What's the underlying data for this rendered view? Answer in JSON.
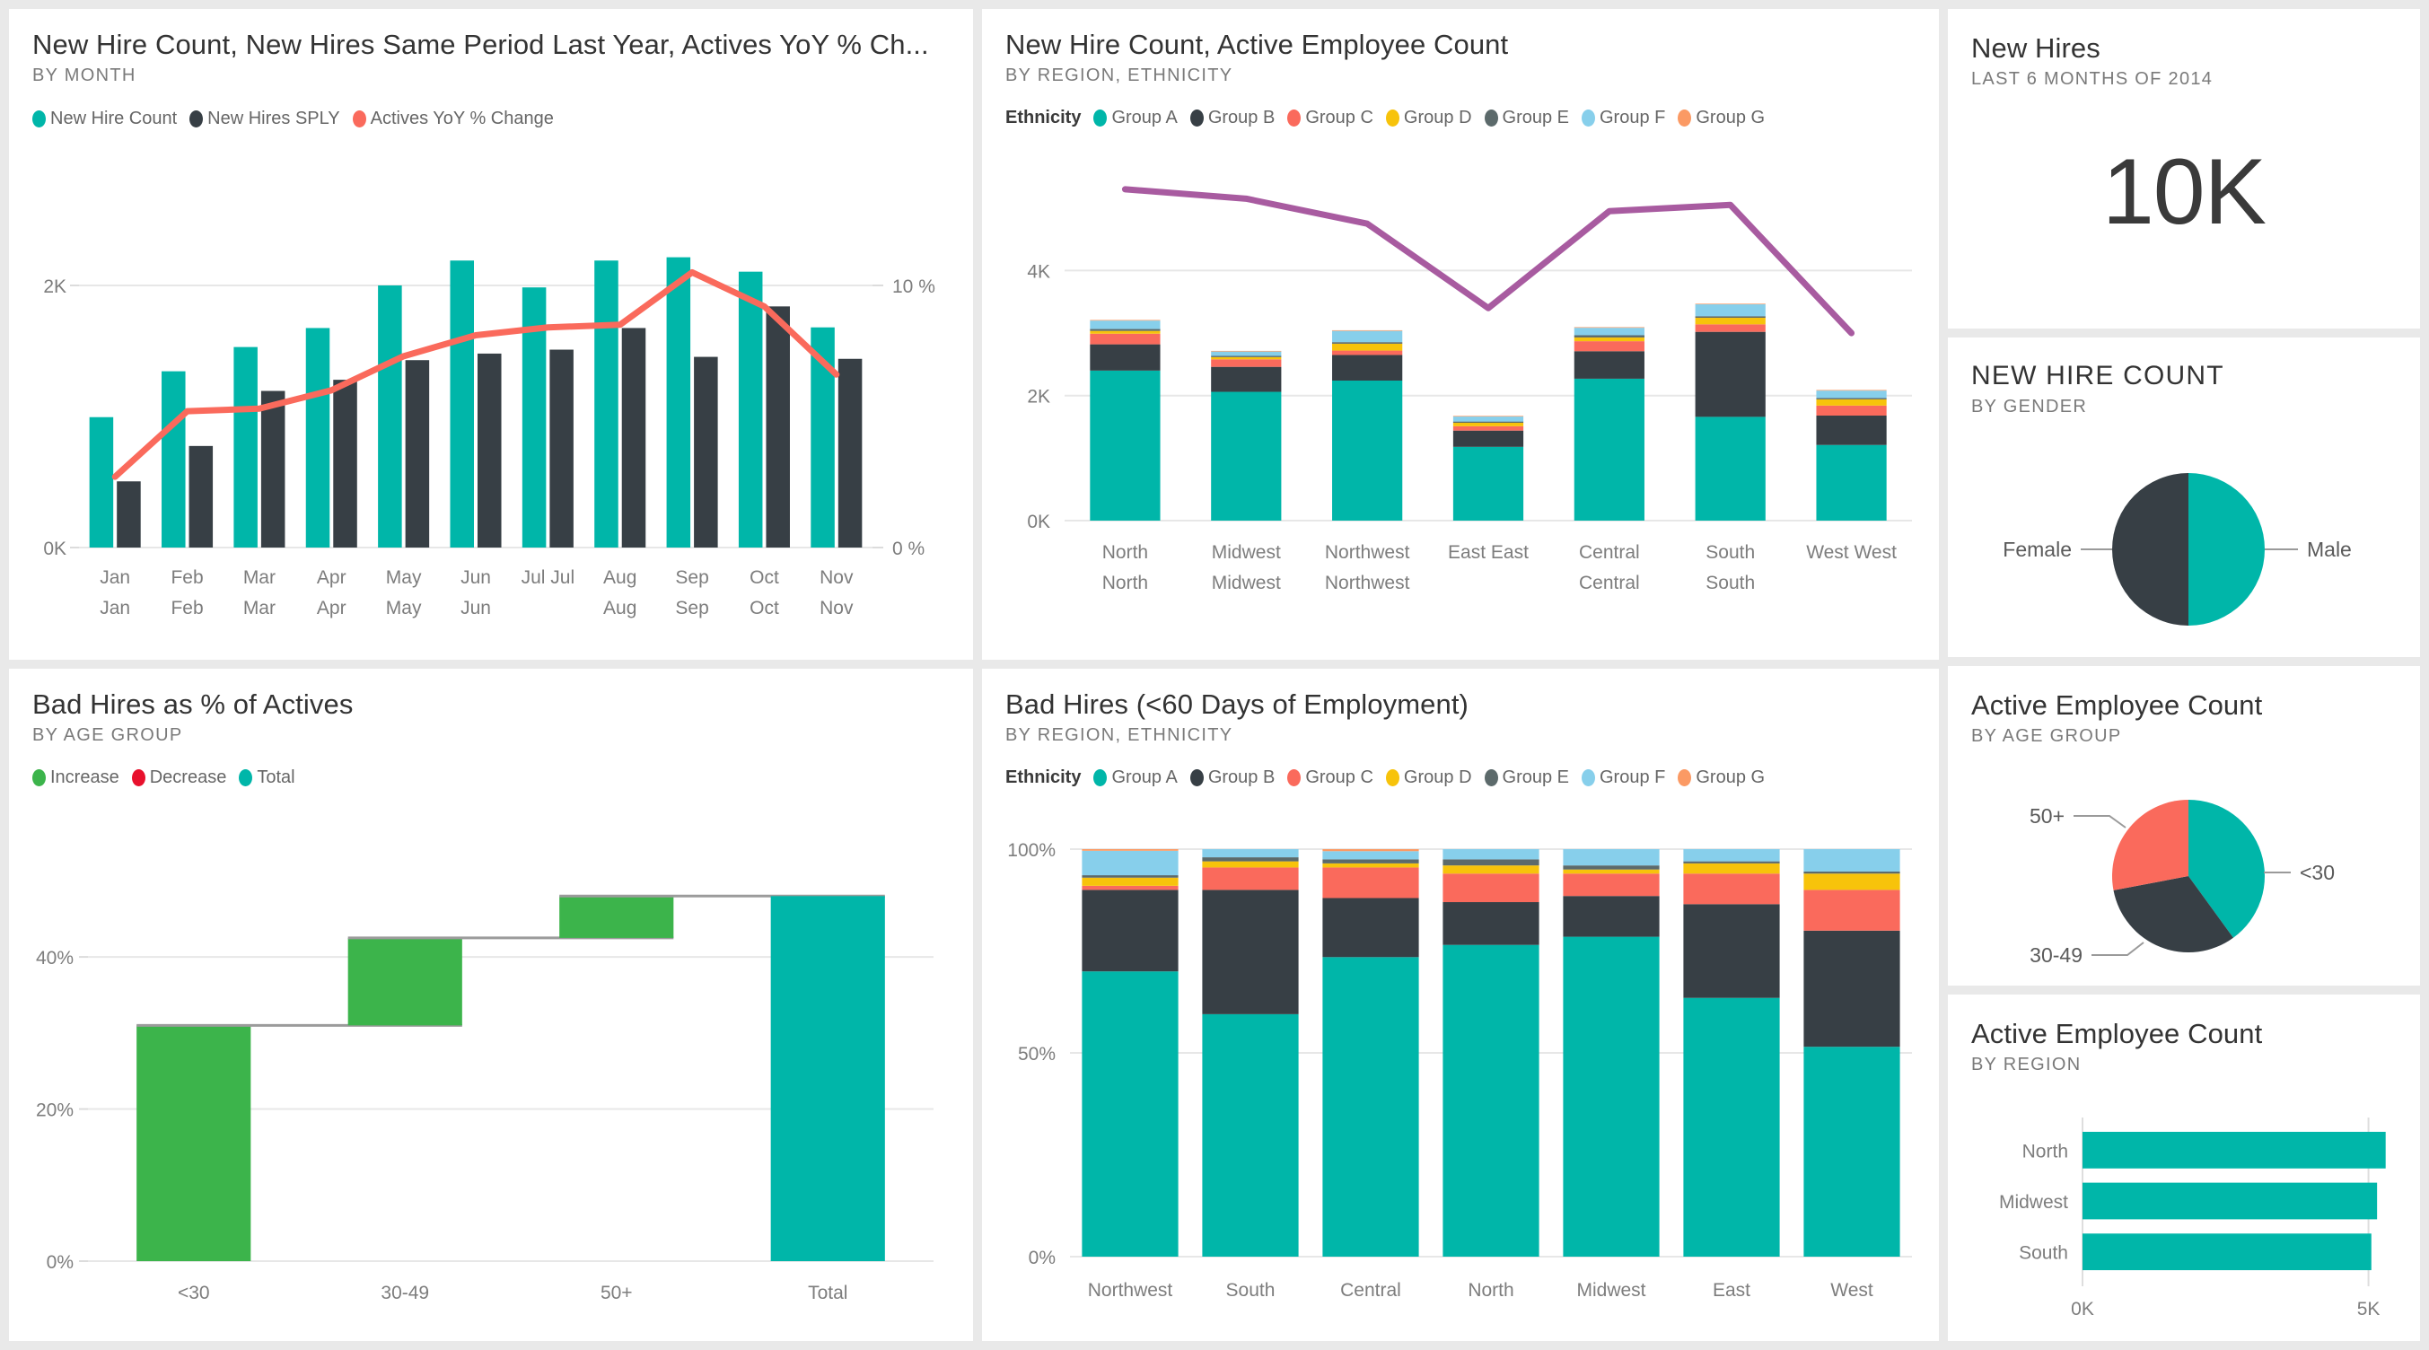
{
  "theme": {
    "page_bg": "#e9e9e9",
    "card_bg": "#ffffff",
    "teal": "#00b6a9",
    "dark": "#373f45",
    "red": "#fa6a5c",
    "yellow": "#f7c30b",
    "gray_green": "#5c6a6b",
    "light_blue": "#87cfeb",
    "orange": "#fb9a64",
    "green": "#3cb44b",
    "decrease_red": "#e8112d",
    "purple": "#a85ba0",
    "text_dark": "#333333",
    "text_muted": "#7a7a7a"
  },
  "cards": {
    "new_hire_trend": {
      "title": "New Hire Count, New Hires Same Period Last Year, Actives YoY % Ch...",
      "subtitle": "BY MONTH",
      "legend": [
        {
          "label": "New Hire Count",
          "color": "#00b6a9"
        },
        {
          "label": "New Hires SPLY",
          "color": "#373f45"
        },
        {
          "label": "Actives YoY % Change",
          "color": "#fa6a5c"
        }
      ]
    },
    "new_hire_active_by_region": {
      "title": "New Hire Count, Active Employee Count",
      "subtitle": "BY REGION, ETHNICITY",
      "legend_title": "Ethnicity",
      "legend": [
        {
          "label": "Group A",
          "color": "#00b6a9"
        },
        {
          "label": "Group B",
          "color": "#373f45"
        },
        {
          "label": "Group C",
          "color": "#fa6a5c"
        },
        {
          "label": "Group D",
          "color": "#f7c30b"
        },
        {
          "label": "Group E",
          "color": "#5c6a6b"
        },
        {
          "label": "Group F",
          "color": "#87cfeb"
        },
        {
          "label": "Group G",
          "color": "#fb9a64"
        }
      ]
    },
    "new_hires_kpi": {
      "title": "New Hires",
      "subtitle": "LAST 6 MONTHS OF 2014",
      "value": "10K"
    },
    "new_hire_by_gender": {
      "title": "NEW HIRE COUNT",
      "subtitle": "BY GENDER"
    },
    "bad_hires_pct": {
      "title": "Bad Hires as % of Actives",
      "subtitle": "BY AGE GROUP",
      "legend": [
        {
          "label": "Increase",
          "color": "#3cb44b"
        },
        {
          "label": "Decrease",
          "color": "#e8112d"
        },
        {
          "label": "Total",
          "color": "#00b6a9"
        }
      ]
    },
    "bad_hires_60days": {
      "title": "Bad Hires (<60 Days of Employment)",
      "subtitle": "BY REGION, ETHNICITY",
      "legend_title": "Ethnicity",
      "legend": [
        {
          "label": "Group A",
          "color": "#00b6a9"
        },
        {
          "label": "Group B",
          "color": "#373f45"
        },
        {
          "label": "Group C",
          "color": "#fa6a5c"
        },
        {
          "label": "Group D",
          "color": "#f7c30b"
        },
        {
          "label": "Group E",
          "color": "#5c6a6b"
        },
        {
          "label": "Group F",
          "color": "#87cfeb"
        },
        {
          "label": "Group G",
          "color": "#fb9a64"
        }
      ]
    },
    "active_by_age": {
      "title": "Active Employee Count",
      "subtitle": "BY AGE GROUP"
    },
    "active_by_region": {
      "title": "Active Employee Count",
      "subtitle": "BY REGION"
    }
  },
  "chart_data": [
    {
      "id": "new_hire_trend",
      "type": "bar",
      "title": "New Hire Count, New Hires Same Period Last Year, Actives YoY % Ch...",
      "subtitle": "BY MONTH",
      "xlabel": "",
      "ylabel": "",
      "categories": [
        "Jan",
        "Feb",
        "Mar",
        "Apr",
        "May",
        "Jun",
        "Jul Jul",
        "Aug",
        "Sep",
        "Oct",
        "Nov"
      ],
      "categories_line2": [
        "Jan",
        "Feb",
        "Mar",
        "Apr",
        "May",
        "Jun",
        "",
        "Aug",
        "Sep",
        "Oct",
        "Nov"
      ],
      "series": [
        {
          "name": "New Hire Count",
          "type": "bar",
          "color": "#00b6a9",
          "values": [
            995,
            1345,
            1530,
            1675,
            2000,
            2190,
            1985,
            2190,
            2215,
            2105,
            1680
          ]
        },
        {
          "name": "New Hires SPLY",
          "type": "bar",
          "color": "#373f45",
          "values": [
            505,
            775,
            1195,
            1280,
            1430,
            1480,
            1510,
            1675,
            1455,
            1840,
            1440
          ]
        },
        {
          "name": "Actives YoY % Change",
          "type": "line",
          "color": "#fa6a5c",
          "axis": "right",
          "values": [
            2.7,
            5.2,
            5.3,
            6.0,
            7.3,
            8.1,
            8.4,
            8.5,
            10.5,
            9.2,
            6.6
          ]
        }
      ],
      "ylim": [
        0,
        2500
      ],
      "yticks": [
        "0K",
        "2K"
      ],
      "ylim_right": [
        0,
        12.5
      ],
      "yticks_right": [
        "0 %",
        "10 %"
      ],
      "grid": true
    },
    {
      "id": "new_hire_active_by_region",
      "type": "bar",
      "title": "New Hire Count, Active Employee Count",
      "subtitle": "BY REGION, ETHNICITY",
      "stacked": true,
      "legend_title": "Ethnicity",
      "categories": [
        "North",
        "Midwest",
        "Northwest",
        "East East",
        "Central",
        "South",
        "West West"
      ],
      "categories_line2": [
        "North",
        "Midwest",
        "Northwest",
        "",
        "Central",
        "South",
        ""
      ],
      "series": [
        {
          "name": "Group A",
          "color": "#00b6a9",
          "values": [
            2400,
            2060,
            2240,
            1180,
            2270,
            1660,
            1210
          ]
        },
        {
          "name": "Group B",
          "color": "#373f45",
          "values": [
            420,
            400,
            410,
            260,
            440,
            1360,
            470
          ]
        },
        {
          "name": "Group C",
          "color": "#fa6a5c",
          "values": [
            170,
            120,
            70,
            70,
            160,
            120,
            160
          ]
        },
        {
          "name": "Group D",
          "color": "#f7c30b",
          "values": [
            45,
            35,
            110,
            55,
            60,
            105,
            100
          ]
        },
        {
          "name": "Group E",
          "color": "#5c6a6b",
          "values": [
            30,
            20,
            25,
            20,
            35,
            25,
            20
          ]
        },
        {
          "name": "Group F",
          "color": "#87cfeb",
          "values": [
            135,
            70,
            180,
            80,
            120,
            190,
            120
          ]
        },
        {
          "name": "Group G",
          "color": "#fb9a64",
          "values": [
            10,
            10,
            10,
            10,
            10,
            10,
            10
          ]
        }
      ],
      "line_series": {
        "name": "Active Employee Count",
        "color": "#a85ba0",
        "axis": "right",
        "values": [
          5300,
          5150,
          4750,
          3400,
          4950,
          5050,
          3000
        ]
      },
      "ylim": [
        0,
        5600
      ],
      "yticks": [
        "0K",
        "2K",
        "4K"
      ],
      "grid": true
    },
    {
      "id": "new_hire_by_gender",
      "type": "pie",
      "title": "NEW HIRE COUNT",
      "subtitle": "BY GENDER",
      "labels": [
        "Male",
        "Female"
      ],
      "values": [
        50,
        50
      ],
      "colors": [
        "#00b6a9",
        "#373f45"
      ]
    },
    {
      "id": "bad_hires_pct",
      "type": "bar",
      "waterfall": true,
      "title": "Bad Hires as % of Actives",
      "subtitle": "BY AGE GROUP",
      "categories": [
        "<30",
        "30-49",
        "50+",
        "Total"
      ],
      "starts": [
        0,
        31,
        42.5,
        0
      ],
      "ends": [
        31,
        42.5,
        48,
        48
      ],
      "kinds": [
        "increase",
        "increase",
        "increase",
        "total"
      ],
      "ylim": [
        0,
        55
      ],
      "yticks": [
        "0%",
        "20%",
        "40%"
      ],
      "grid": true
    },
    {
      "id": "bad_hires_60days",
      "type": "bar",
      "stacked": true,
      "percent": true,
      "title": "Bad Hires (<60 Days of Employment)",
      "subtitle": "BY REGION, ETHNICITY",
      "legend_title": "Ethnicity",
      "categories": [
        "Northwest",
        "South",
        "Central",
        "North",
        "Midwest",
        "East",
        "West"
      ],
      "series": [
        {
          "name": "Group A",
          "color": "#00b6a9",
          "values": [
            70.0,
            59.5,
            73.5,
            76.5,
            78.5,
            63.5,
            51.5
          ]
        },
        {
          "name": "Group B",
          "color": "#373f45",
          "values": [
            20.0,
            30.5,
            14.5,
            10.5,
            10.0,
            23.0,
            28.5
          ]
        },
        {
          "name": "Group C",
          "color": "#fa6a5c",
          "values": [
            1.0,
            5.5,
            7.5,
            7.0,
            5.5,
            7.5,
            10.0
          ]
        },
        {
          "name": "Group D",
          "color": "#f7c30b",
          "values": [
            2.0,
            1.5,
            1.0,
            2.0,
            1.0,
            2.5,
            4.0
          ]
        },
        {
          "name": "Group E",
          "color": "#5c6a6b",
          "values": [
            0.6,
            1.0,
            1.0,
            1.5,
            1.0,
            0.5,
            0.5
          ]
        },
        {
          "name": "Group F",
          "color": "#87cfeb",
          "values": [
            6.0,
            2.0,
            2.0,
            2.5,
            4.0,
            3.0,
            5.5
          ]
        },
        {
          "name": "Group G",
          "color": "#fb9a64",
          "values": [
            0.4,
            0.0,
            0.5,
            0.0,
            0.0,
            0.0,
            0.0
          ]
        }
      ],
      "ylim": [
        0,
        100
      ],
      "yticks": [
        "0%",
        "50%",
        "100%"
      ],
      "grid": true
    },
    {
      "id": "active_by_age",
      "type": "pie",
      "title": "Active Employee Count",
      "subtitle": "BY AGE GROUP",
      "labels": [
        "<30",
        "30-49",
        "50+"
      ],
      "values": [
        40,
        32,
        28
      ],
      "colors": [
        "#00b6a9",
        "#373f45",
        "#fa6a5c"
      ]
    },
    {
      "id": "active_by_region",
      "type": "bar",
      "horizontal": true,
      "title": "Active Employee Count",
      "subtitle": "BY REGION",
      "categories": [
        "North",
        "Midwest",
        "South"
      ],
      "values": [
        5300,
        5150,
        5050
      ],
      "color": "#00b6a9",
      "xlim": [
        0,
        5650
      ],
      "xticks": [
        "0K",
        "5K"
      ],
      "grid": true
    }
  ]
}
